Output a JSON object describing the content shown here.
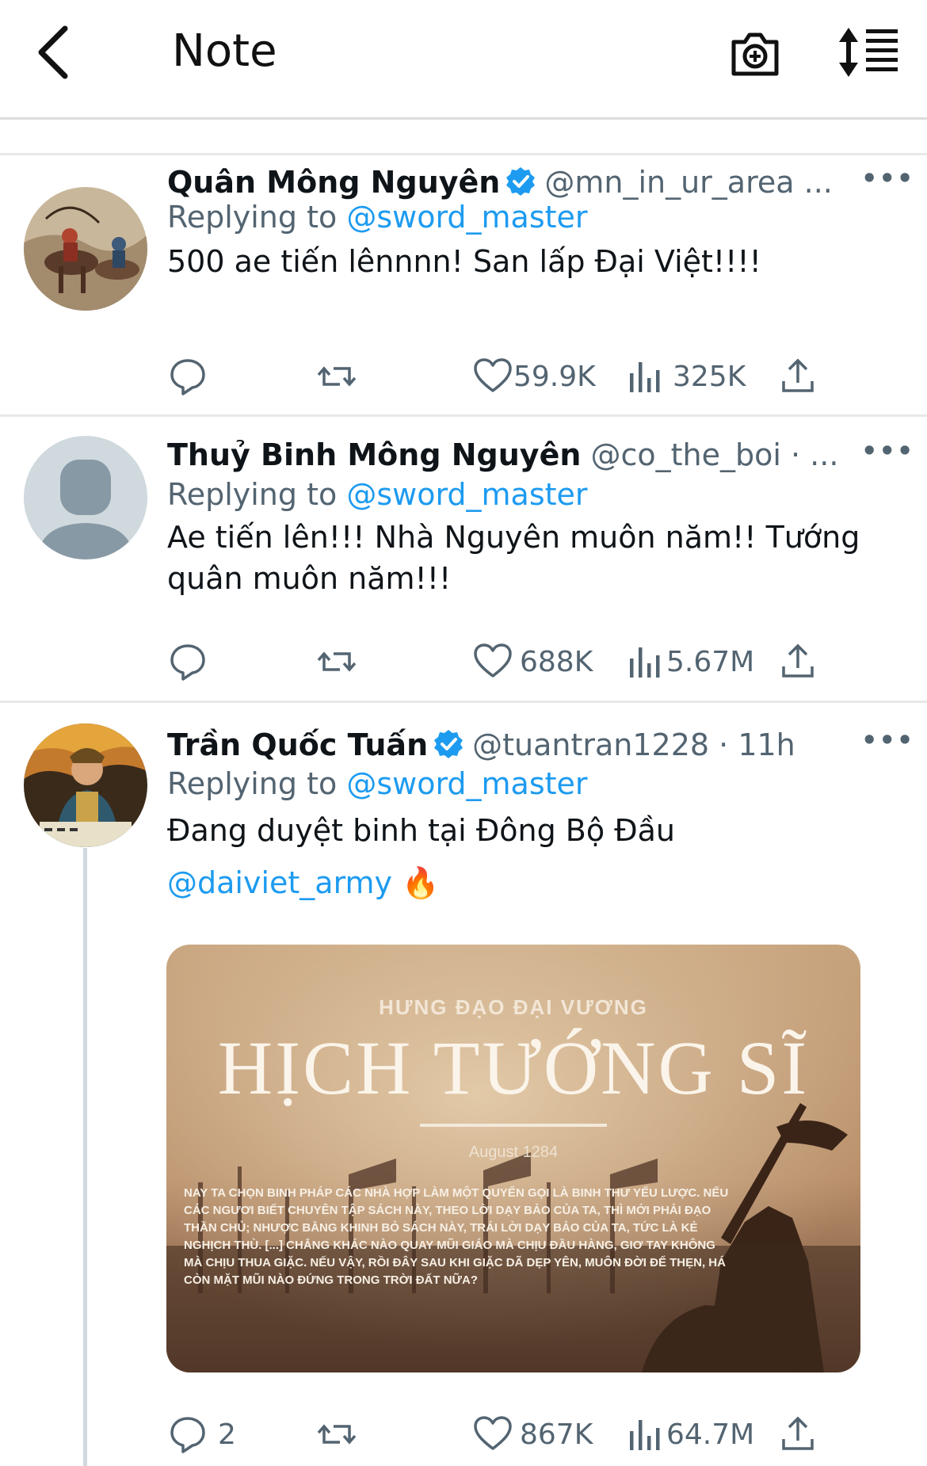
{
  "header": {
    "title": "Note",
    "back_icon": "chevron-left-icon",
    "camera_icon": "camera-plus-icon",
    "sort_icon": "sort-lines-icon"
  },
  "tweets": [
    {
      "name": "Quân Mông Nguyên",
      "verified": true,
      "handle": "@mn_in_ur_area ...",
      "replying_prefix": "Replying to ",
      "replying_to": "@sword_master",
      "text": "500 ae tiến lênnnn! San lấp Đại Việt!!!!",
      "likes": "59.9K",
      "views": "325K",
      "replies": ""
    },
    {
      "name": "Thuỷ Binh Mông Nguyên",
      "verified": false,
      "handle": "@co_the_boi · ...",
      "replying_prefix": "Replying to ",
      "replying_to": "@sword_master",
      "text_line1": "Ae tiến lên!!! Nhà Nguyên muôn năm!! Tướng",
      "text_line2": "quân muôn năm!!!",
      "likes": "688K",
      "views": "5.67M",
      "replies": ""
    },
    {
      "name": "Trần Quốc Tuấn",
      "verified": true,
      "handle": "@tuantran1228 · 11h",
      "replying_prefix": "Replying to ",
      "replying_to": "@sword_master",
      "text": "Đang duyệt binh tại Đông Bộ Đầu",
      "mention": "@daiviet_army",
      "emoji": "🔥",
      "likes": "867K",
      "views": "64.7M",
      "replies": "2",
      "media": {
        "subtitle": "HƯNG ĐẠO ĐẠI VƯƠNG",
        "title": "HỊCH TƯỚNG SĨ",
        "date": "August 1284",
        "para_lines": [
          "NAY TA CHỌN BINH PHÁP CÁC NHÀ HỢP LÀM MỘT QUYỂN GỌI LÀ BINH THƯ YẾU LƯỢC. NẾU",
          "CÁC NGƯƠI BIẾT CHUYÊN TẬP SÁCH NÀY, THEO LỜI DẠY BẢO CỦA TA, THÌ MỚI PHẢI ĐẠO",
          "THẦN CHỦ; NHƯỢC BẰNG KHINH BỎ SÁCH NÀY, TRÁI LỜI DẠY BẢO CỦA TA, TỨC LÀ KẺ",
          "NGHỊCH THÙ. [...] CHẲNG KHÁC NÀO QUAY MŨI GIÁO MÀ CHỊU ĐẦU HÀNG, GIƠ TAY KHÔNG",
          "MÀ CHỊU THUA GIẶC. NẾU VẬY, RỒI ĐÂY SAU KHI GIẶC DÃ DẸP YÊN, MUÔN ĐỜI ĐỂ THẸN, HÁ",
          "CÒN MẶT MŨI NÀO ĐỨNG TRONG TRỜI ĐẤT NỮA?"
        ]
      }
    }
  ],
  "icons": [
    "reply-icon",
    "retweet-icon",
    "like-icon",
    "views-icon",
    "share-icon",
    "more-icon",
    "verified-icon"
  ],
  "colors": {
    "link": "#1d9bf0",
    "muted": "#536471",
    "text": "#0f1419"
  }
}
